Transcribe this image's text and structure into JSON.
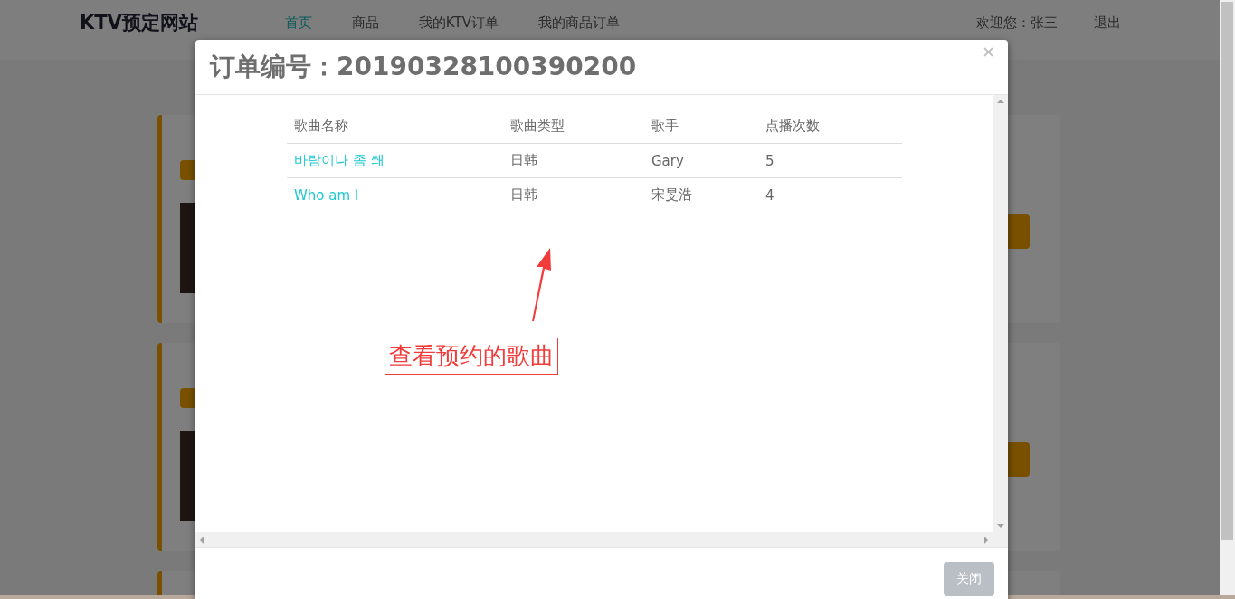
{
  "site": {
    "logo": "KTV预定网站",
    "nav": [
      {
        "label": "首页",
        "selected": true
      },
      {
        "label": "商品",
        "selected": false
      },
      {
        "label": "我的KTV订单",
        "selected": false
      },
      {
        "label": "我的商品订单",
        "selected": false
      }
    ],
    "welcome": "欢迎您：张三",
    "logout": "退出"
  },
  "modal": {
    "title": "订单编号：20190328100390200",
    "columns": [
      "歌曲名称",
      "歌曲类型",
      "歌手",
      "点播次数"
    ],
    "rows": [
      {
        "song": "바람이나 좀 쐐",
        "type": "日韩",
        "singer": "Gary",
        "plays": "5"
      },
      {
        "song": "Who am I",
        "type": "日韩",
        "singer": "宋旻浩",
        "plays": "4"
      }
    ],
    "close_button": "关闭"
  },
  "annotation": {
    "text": "查看预约的歌曲"
  }
}
